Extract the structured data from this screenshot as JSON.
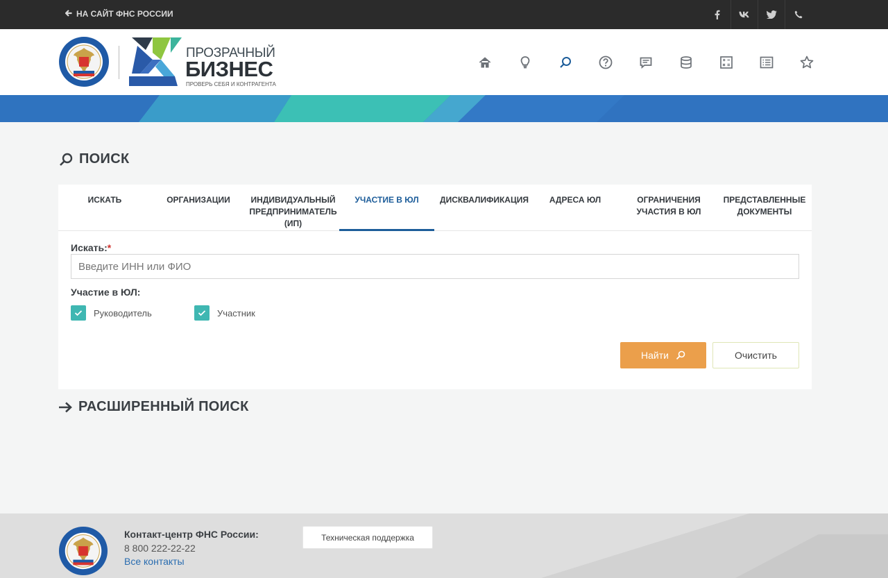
{
  "topbar": {
    "back_label": "НА САЙТ ФНС РОССИИ",
    "social": [
      {
        "icon": "facebook-icon",
        "glyph": "f"
      },
      {
        "icon": "vk-icon",
        "glyph": "vk"
      },
      {
        "icon": "twitter-icon",
        "glyph": "twitter"
      },
      {
        "icon": "phone-icon",
        "glyph": "phone"
      }
    ]
  },
  "header": {
    "brand_line1": "ПРОЗРАЧНЫЙ",
    "brand_line2": "БИЗНЕС",
    "brand_tagline": "ПРОВЕРЬ СЕБЯ И КОНТРАГЕНТА",
    "nav_icons": [
      "home-icon",
      "lightbulb-icon",
      "search-icon",
      "help-icon",
      "chat-icon",
      "database-icon",
      "calculator-icon",
      "list-icon",
      "star-icon"
    ]
  },
  "page": {
    "title": "ПОИСК",
    "advanced_search": "РАСШИРЕННЫЙ ПОИСК"
  },
  "tabs": [
    {
      "label": "ИСКАТЬ",
      "active": false
    },
    {
      "label": "ОРГАНИЗАЦИИ",
      "active": false
    },
    {
      "label": "ИНДИВИДУАЛЬНЫЙ ПРЕДПРИНИМАТЕЛЬ (ИП)",
      "active": false
    },
    {
      "label": "УЧАСТИЕ В ЮЛ",
      "active": true
    },
    {
      "label": "ДИСКВАЛИФИКАЦИЯ",
      "active": false
    },
    {
      "label": "АДРЕСА ЮЛ",
      "active": false
    },
    {
      "label": "ОГРАНИЧЕНИЯ УЧАСТИЯ В ЮЛ",
      "active": false
    },
    {
      "label": "ПРЕДСТАВЛЕННЫЕ ДОКУМЕНТЫ",
      "active": false
    }
  ],
  "form": {
    "search_label": "Искать:",
    "required_mark": "*",
    "search_placeholder": "Введите ИНН или ФИО",
    "search_value": "",
    "participation_label": "Участие в ЮЛ:",
    "checkboxes": [
      {
        "label": "Руководитель",
        "checked": true
      },
      {
        "label": "Участник",
        "checked": true
      }
    ],
    "find_button": "Найти",
    "clear_button": "Очистить"
  },
  "footer": {
    "contact_title": "Контакт-центр ФНС России:",
    "phone": "8 800 222-22-22",
    "all_contacts": "Все контакты",
    "support_button": "Техническая поддержка"
  },
  "colors": {
    "accent_blue": "#1d5d9a",
    "teal": "#3fb7b2",
    "orange": "#eb9f4b",
    "topbar": "#2b2b2b"
  }
}
